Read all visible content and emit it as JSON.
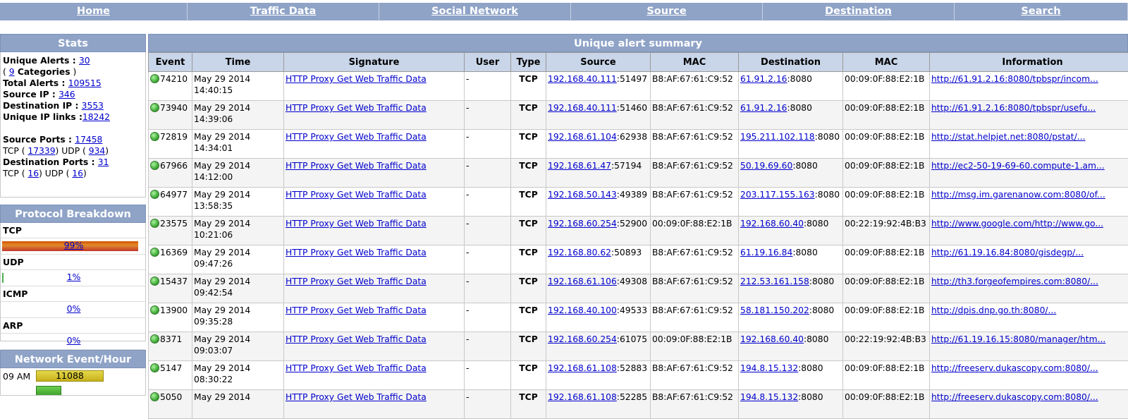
{
  "nav": {
    "items": [
      {
        "label": "Home"
      },
      {
        "label": "Traffic Data"
      },
      {
        "label": "Social Network"
      },
      {
        "label": "Source"
      },
      {
        "label": "Destination"
      },
      {
        "label": "Search"
      }
    ]
  },
  "stats": {
    "title": "Stats",
    "unique_alerts_label": "Unique Alerts : ",
    "unique_alerts": "30",
    "categories_open": "( ",
    "categories": "9",
    "categories_label": " Categories",
    "categories_close": " )",
    "total_alerts_label": "Total Alerts : ",
    "total_alerts": "109515",
    "source_ip_label": "Source IP : ",
    "source_ip": "346",
    "dest_ip_label": "Destination IP : ",
    "dest_ip": "3553",
    "unique_links_label": "Unique IP links :",
    "unique_links": "18242",
    "source_ports_label": "Source Ports : ",
    "source_ports": "17458",
    "src_tcp_label": "TCP ( ",
    "src_tcp": "17339",
    "src_udp_label": ") UDP ( ",
    "src_udp": "934",
    "src_close": ")",
    "dest_ports_label": "Destination Ports : ",
    "dest_ports": "31",
    "dst_tcp_label": "TCP ( ",
    "dst_tcp": "16",
    "dst_udp_label": ") UDP ( ",
    "dst_udp": "16",
    "dst_close": ")"
  },
  "protocol": {
    "title": "Protocol Breakdown",
    "items": [
      {
        "name": "TCP",
        "percent_label": "99%",
        "percent": 99
      },
      {
        "name": "UDP",
        "percent_label": "1%",
        "percent": 1
      },
      {
        "name": "ICMP",
        "percent_label": "0%",
        "percent": 0
      },
      {
        "name": "ARP",
        "percent_label": "0%",
        "percent": 0
      }
    ]
  },
  "network_hour": {
    "title": "Network Event/Hour",
    "rows": [
      {
        "hour": "09 AM",
        "count": "11088"
      }
    ]
  },
  "summary": {
    "title": "Unique alert summary",
    "columns": [
      "Event",
      "Time",
      "Signature",
      "User",
      "Type",
      "Source",
      "MAC",
      "Destination",
      "MAC",
      "Information"
    ],
    "rows": [
      {
        "event": "74210",
        "date": "May 29 2014",
        "time": "14:40:15",
        "signature": "HTTP Proxy Get Web Traffic Data",
        "user": "-",
        "type": "TCP",
        "src_ip": "192.168.40.111",
        "src_port": ":51497",
        "src_mac": "B8:AF:67:61:C9:52",
        "dst_ip": "61.91.2.16",
        "dst_port": ":8080",
        "dst_mac": "00:09:0F:88:E2:1B",
        "info": "http://61.91.2.16:8080/tpbspr/incom..."
      },
      {
        "event": "73940",
        "date": "May 29 2014",
        "time": "14:39:06",
        "signature": "HTTP Proxy Get Web Traffic Data",
        "user": "-",
        "type": "TCP",
        "src_ip": "192.168.40.111",
        "src_port": ":51460",
        "src_mac": "B8:AF:67:61:C9:52",
        "dst_ip": "61.91.2.16",
        "dst_port": ":8080",
        "dst_mac": "00:09:0F:88:E2:1B",
        "info": "http://61.91.2.16:8080/tpbspr/usefu..."
      },
      {
        "event": "72819",
        "date": "May 29 2014",
        "time": "14:34:01",
        "signature": "HTTP Proxy Get Web Traffic Data",
        "user": "-",
        "type": "TCP",
        "src_ip": "192.168.61.104",
        "src_port": ":62938",
        "src_mac": "B8:AF:67:61:C9:52",
        "dst_ip": "195.211.102.118",
        "dst_port": ":8080",
        "dst_mac": "00:09:0F:88:E2:1B",
        "info": "http://stat.helpjet.net:8080/pstat/..."
      },
      {
        "event": "67966",
        "date": "May 29 2014",
        "time": "14:12:00",
        "signature": "HTTP Proxy Get Web Traffic Data",
        "user": "-",
        "type": "TCP",
        "src_ip": "192.168.61.47",
        "src_port": ":57194",
        "src_mac": "B8:AF:67:61:C9:52",
        "dst_ip": "50.19.69.60",
        "dst_port": ":8080",
        "dst_mac": "00:09:0F:88:E2:1B",
        "info": "http://ec2-50-19-69-60.compute-1.am..."
      },
      {
        "event": "64977",
        "date": "May 29 2014",
        "time": "13:58:35",
        "signature": "HTTP Proxy Get Web Traffic Data",
        "user": "-",
        "type": "TCP",
        "src_ip": "192.168.50.143",
        "src_port": ":49389",
        "src_mac": "B8:AF:67:61:C9:52",
        "dst_ip": "203.117.155.163",
        "dst_port": ":8080",
        "dst_mac": "00:09:0F:88:E2:1B",
        "info": "http://msg.im.garenanow.com:8080/of..."
      },
      {
        "event": "23575",
        "date": "May 29 2014",
        "time": "10:21:06",
        "signature": "HTTP Proxy Get Web Traffic Data",
        "user": "-",
        "type": "TCP",
        "src_ip": "192.168.60.254",
        "src_port": ":52900",
        "src_mac": "00:09:0F:88:E2:1B",
        "dst_ip": "192.168.60.40",
        "dst_port": ":8080",
        "dst_mac": "00:22:19:92:4B:B3",
        "info": "http://www.google.com/http://www.go..."
      },
      {
        "event": "16369",
        "date": "May 29 2014",
        "time": "09:47:26",
        "signature": "HTTP Proxy Get Web Traffic Data",
        "user": "-",
        "type": "TCP",
        "src_ip": "192.168.80.62",
        "src_port": ":50893",
        "src_mac": "B8:AF:67:61:C9:52",
        "dst_ip": "61.19.16.84",
        "dst_port": ":8080",
        "dst_mac": "00:09:0F:88:E2:1B",
        "info": "http://61.19.16.84:8080/gisdegp/..."
      },
      {
        "event": "15437",
        "date": "May 29 2014",
        "time": "09:42:54",
        "signature": "HTTP Proxy Get Web Traffic Data",
        "user": "-",
        "type": "TCP",
        "src_ip": "192.168.61.106",
        "src_port": ":49308",
        "src_mac": "B8:AF:67:61:C9:52",
        "dst_ip": "212.53.161.158",
        "dst_port": ":8080",
        "dst_mac": "00:09:0F:88:E2:1B",
        "info": "http://th3.forgeofempires.com:8080/..."
      },
      {
        "event": "13900",
        "date": "May 29 2014",
        "time": "09:35:28",
        "signature": "HTTP Proxy Get Web Traffic Data",
        "user": "-",
        "type": "TCP",
        "src_ip": "192.168.40.100",
        "src_port": ":49533",
        "src_mac": "B8:AF:67:61:C9:52",
        "dst_ip": "58.181.150.202",
        "dst_port": ":8080",
        "dst_mac": "00:09:0F:88:E2:1B",
        "info": "http://dpis.dnp.go.th:8080/..."
      },
      {
        "event": "8371",
        "date": "May 29 2014",
        "time": "09:03:07",
        "signature": "HTTP Proxy Get Web Traffic Data",
        "user": "-",
        "type": "TCP",
        "src_ip": "192.168.60.254",
        "src_port": ":61075",
        "src_mac": "00:09:0F:88:E2:1B",
        "dst_ip": "192.168.60.40",
        "dst_port": ":8080",
        "dst_mac": "00:22:19:92:4B:B3",
        "info": "http://61.19.16.15:8080/manager/htm..."
      },
      {
        "event": "5147",
        "date": "May 29 2014",
        "time": "08:30:22",
        "signature": "HTTP Proxy Get Web Traffic Data",
        "user": "-",
        "type": "TCP",
        "src_ip": "192.168.61.108",
        "src_port": ":52883",
        "src_mac": "B8:AF:67:61:C9:52",
        "dst_ip": "194.8.15.132",
        "dst_port": ":8080",
        "dst_mac": "00:09:0F:88:E2:1B",
        "info": "http://freeserv.dukascopy.com:8080/..."
      },
      {
        "event": "5050",
        "date": "May 29 2014",
        "time": "",
        "signature": "HTTP Proxy Get Web Traffic Data",
        "user": "-",
        "type": "TCP",
        "src_ip": "192.168.61.108",
        "src_port": ":52285",
        "src_mac": "B8:AF:67:61:C9:52",
        "dst_ip": "194.8.15.132",
        "dst_port": ":8080",
        "dst_mac": "00:09:0F:88:E2:1B",
        "info": "http://freeserv.dukascopy.com:8080/..."
      }
    ]
  }
}
